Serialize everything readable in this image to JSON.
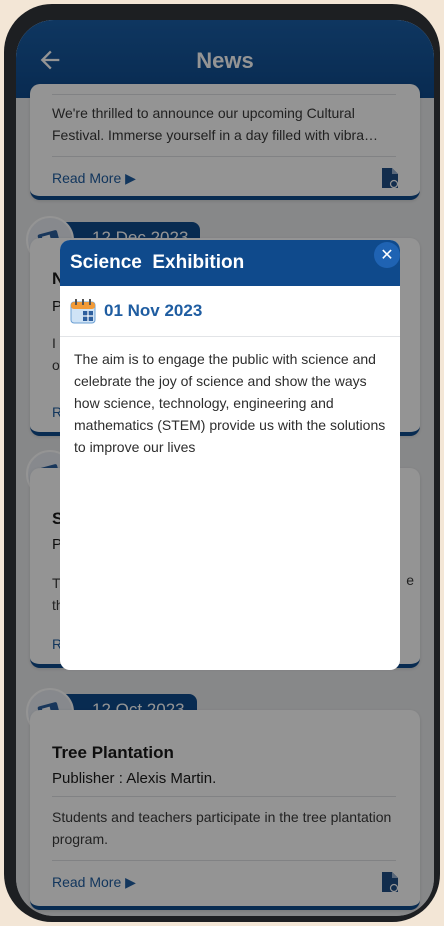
{
  "header": {
    "title": "News"
  },
  "cards": [
    {
      "description": "We're thrilled to announce our upcoming Cultural Festival. Immerse yourself in a day filled with vibra…",
      "read_more": "Read More ▶"
    },
    {
      "date": "12 Dec 2023",
      "title_partial": "N",
      "publisher_partial": "P",
      "text_partial_1": "I",
      "text_partial_2": "o",
      "read_more_partial": "R"
    },
    {
      "title_partial": "S",
      "publisher_partial": "P",
      "text_partial_1": "T",
      "text_partial_2": "th",
      "text_partial_right": "e",
      "read_more_partial": "R"
    },
    {
      "date": "12 Oct 2023",
      "title": "Tree Plantation",
      "publisher": "Publisher : Alexis Martin.",
      "description": "Students and teachers participate in the tree plantation program.",
      "read_more": "Read More ▶"
    }
  ],
  "modal": {
    "title": "Science  Exhibition",
    "date": "01 Nov 2023",
    "body": "The aim is to engage the public with science and celebrate the joy of science and show the ways how science, technology, engineering and mathematics (STEM) provide us with the solutions to improve our lives",
    "close_label": "✕"
  },
  "colors": {
    "primary": "#0f4a8c",
    "link": "#1f5da1"
  }
}
